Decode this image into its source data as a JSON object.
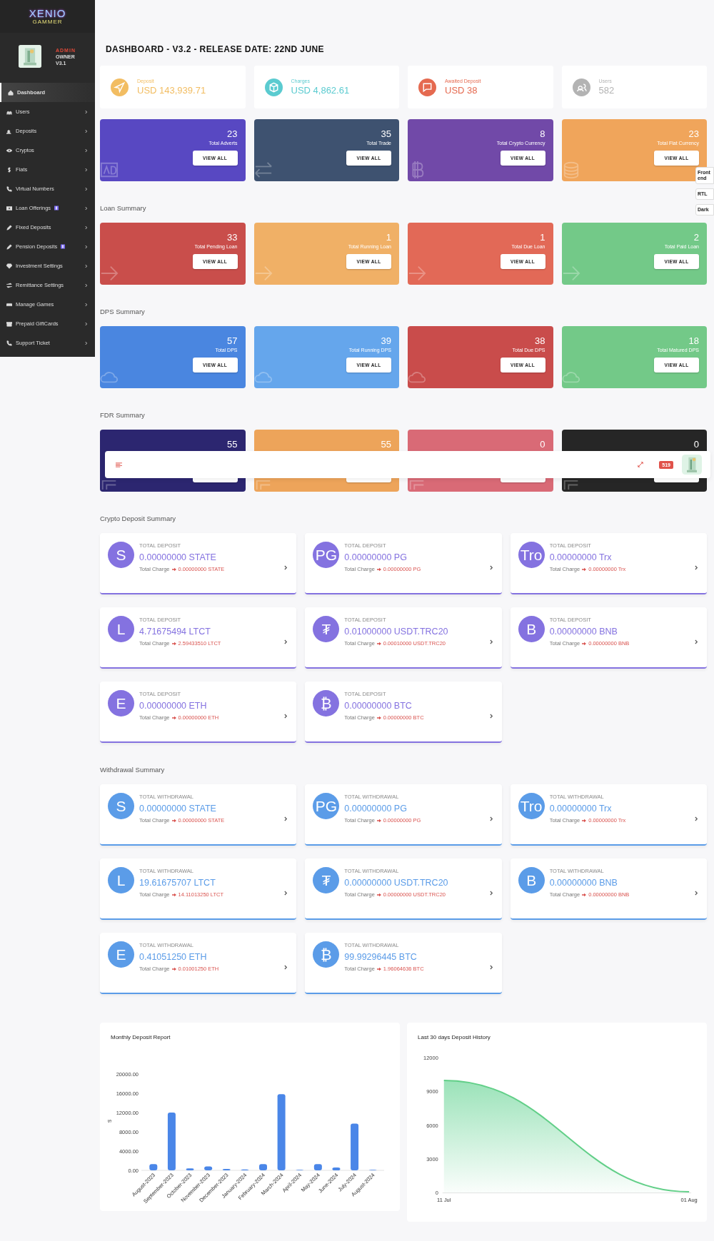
{
  "sidebar": {
    "logo": {
      "line1": "XENIO",
      "line2": "GAMMER"
    },
    "profile": {
      "role": "ADMIN",
      "title": "OWNER",
      "version": "V3.1"
    },
    "items": [
      {
        "label": "Dashboard",
        "selected": true,
        "badge": false,
        "submenu": false
      },
      {
        "label": "Users",
        "selected": false,
        "badge": false,
        "submenu": true
      },
      {
        "label": "Deposits",
        "selected": false,
        "badge": false,
        "submenu": true
      },
      {
        "label": "Cryptos",
        "selected": false,
        "badge": false,
        "submenu": true
      },
      {
        "label": "Fiats",
        "selected": false,
        "badge": false,
        "submenu": true
      },
      {
        "label": "Virtual Numbers",
        "selected": false,
        "badge": false,
        "submenu": true
      },
      {
        "label": "Loan Offerings",
        "selected": false,
        "badge": true,
        "submenu": true
      },
      {
        "label": "Fixed Deposits",
        "selected": false,
        "badge": false,
        "submenu": true
      },
      {
        "label": "Pension Deposits",
        "selected": false,
        "badge": true,
        "submenu": true
      },
      {
        "label": "Investment Settings",
        "selected": false,
        "badge": false,
        "submenu": true
      },
      {
        "label": "Remittance Settings",
        "selected": false,
        "badge": false,
        "submenu": true
      },
      {
        "label": "Manage Games",
        "selected": false,
        "badge": false,
        "submenu": true
      },
      {
        "label": "Prepaid GiftCards",
        "selected": false,
        "badge": false,
        "submenu": true
      },
      {
        "label": "Support Ticket",
        "selected": false,
        "badge": false,
        "submenu": true
      }
    ]
  },
  "side_tabs": [
    "Front end",
    "RTL",
    "Dark"
  ],
  "page_title": "DASHBOARD - V3.2 - RELEASE DATE: 22ND JUNE",
  "stats": [
    {
      "label": "Deposit",
      "value": "USD 143,939.71",
      "color": "#f2bd62"
    },
    {
      "label": "Charges",
      "value": "USD 4,862.61",
      "color": "#5bcbd0"
    },
    {
      "label": "Awaited Deposit",
      "value": "USD 38",
      "color": "#e56a50"
    },
    {
      "label": "Users",
      "value": "582",
      "color": "#b3b3b3"
    }
  ],
  "card_sections": [
    {
      "cards": [
        {
          "number": "23",
          "label": "Total Adverts",
          "button": "VIEW ALL",
          "color": "#5848c2"
        },
        {
          "number": "35",
          "label": "Total Trade",
          "button": "VIEW ALL",
          "color": "#3e5270"
        },
        {
          "number": "8",
          "label": "Total Crypto Currency",
          "button": "VIEW ALL",
          "color": "#7149a8"
        },
        {
          "number": "23",
          "label": "Total Flat Currency",
          "button": "VIEW ALL",
          "color": "#f0a55b"
        }
      ]
    },
    {
      "title": "Loan Summary",
      "cards": [
        {
          "number": "33",
          "label": "Total Pending Loan",
          "button": "VIEW ALL",
          "color": "#c94e4b"
        },
        {
          "number": "1",
          "label": "Total Running Loan",
          "button": "VIEW ALL",
          "color": "#f0b066"
        },
        {
          "number": "1",
          "label": "Total Due Loan",
          "button": "VIEW ALL",
          "color": "#e26957"
        },
        {
          "number": "2",
          "label": "Total Paid Loan",
          "button": "VIEW ALL",
          "color": "#73c988"
        }
      ]
    },
    {
      "title": "DPS Summary",
      "cards": [
        {
          "number": "57",
          "label": "Total DPS",
          "button": "VIEW ALL",
          "color": "#4a86e0"
        },
        {
          "number": "39",
          "label": "Total Running DPS",
          "button": "VIEW ALL",
          "color": "#65a6ec"
        },
        {
          "number": "38",
          "label": "Total Due DPS",
          "button": "VIEW ALL",
          "color": "#c94c4b"
        },
        {
          "number": "18",
          "label": "Total Matured DPS",
          "button": "VIEW ALL",
          "color": "#73c988"
        }
      ]
    },
    {
      "title": "FDR Summary",
      "header_overlay": {
        "notifications": "519"
      },
      "cards": [
        {
          "number": "55",
          "color": "#2c2670"
        },
        {
          "number": "55",
          "color": "#eda45a"
        },
        {
          "number": "0",
          "color": "#d96a76"
        },
        {
          "number": "0",
          "color": "#262626"
        }
      ]
    }
  ],
  "crypto_sections": [
    {
      "title": "Crypto Deposit Summary",
      "kind": "deposit",
      "cards": [
        {
          "symbol": "S",
          "label": "TOTAL DEPOSIT",
          "amount": "0.00000000 STATE",
          "charge_label": "Total Charge",
          "charge": "0.00000000 STATE"
        },
        {
          "symbol": "PG",
          "label": "TOTAL DEPOSIT",
          "amount": "0.00000000 PG",
          "charge_label": "Total Charge",
          "charge": "0.00000000 PG"
        },
        {
          "symbol": "Tro",
          "label": "TOTAL DEPOSIT",
          "amount": "0.00000000 Trx",
          "charge_label": "Total Charge",
          "charge": "0.00000000 Trx"
        },
        {
          "symbol": "L",
          "label": "TOTAL DEPOSIT",
          "amount": "4.71675494 LTCT",
          "charge_label": "Total Charge",
          "charge": "2.59433510 LTCT"
        },
        {
          "symbol": "₮",
          "label": "TOTAL DEPOSIT",
          "amount": "0.01000000 USDT.TRC20",
          "charge_label": "Total Charge",
          "charge": "0.00010000 USDT.TRC20"
        },
        {
          "symbol": "B",
          "label": "TOTAL DEPOSIT",
          "amount": "0.00000000 BNB",
          "charge_label": "Total Charge",
          "charge": "0.00000000 BNB"
        },
        {
          "symbol": "E",
          "label": "TOTAL DEPOSIT",
          "amount": "0.00000000 ETH",
          "charge_label": "Total Charge",
          "charge": "0.00000000 ETH"
        },
        {
          "symbol": "₿",
          "label": "TOTAL DEPOSIT",
          "amount": "0.00000000 BTC",
          "charge_label": "Total Charge",
          "charge": "0.00000000 BTC"
        }
      ]
    },
    {
      "title": "Withdrawal Summary",
      "kind": "withdrawal",
      "cards": [
        {
          "symbol": "S",
          "label": "TOTAL WITHDRAWAL",
          "amount": "0.00000000 STATE",
          "charge_label": "Total Charge",
          "charge": "0.00000000 STATE"
        },
        {
          "symbol": "PG",
          "label": "TOTAL WITHDRAWAL",
          "amount": "0.00000000 PG",
          "charge_label": "Total Charge",
          "charge": "0.00000000 PG"
        },
        {
          "symbol": "Tro",
          "label": "TOTAL WITHDRAWAL",
          "amount": "0.00000000 Trx",
          "charge_label": "Total Charge",
          "charge": "0.00000000 Trx"
        },
        {
          "symbol": "L",
          "label": "TOTAL WITHDRAWAL",
          "amount": "19.61675707 LTCT",
          "charge_label": "Total Charge",
          "charge": "14.11013250 LTCT"
        },
        {
          "symbol": "₮",
          "label": "TOTAL WITHDRAWAL",
          "amount": "0.00000000 USDT.TRC20",
          "charge_label": "Total Charge",
          "charge": "0.00000000 USDT.TRC20"
        },
        {
          "symbol": "B",
          "label": "TOTAL WITHDRAWAL",
          "amount": "0.00000000 BNB",
          "charge_label": "Total Charge",
          "charge": "0.00000000 BNB"
        },
        {
          "symbol": "E",
          "label": "TOTAL WITHDRAWAL",
          "amount": "0.41051250 ETH",
          "charge_label": "Total Charge",
          "charge": "0.01001250 ETH"
        },
        {
          "symbol": "₿",
          "label": "TOTAL WITHDRAWAL",
          "amount": "99.99296445 BTC",
          "charge_label": "Total Charge",
          "charge": "1.96064636 BTC"
        }
      ]
    }
  ],
  "charts": [
    {
      "chart_data": {
        "type": "bar",
        "title": "Monthly Deposit Report",
        "ylabel": "$",
        "categories": [
          "August-2023",
          "September-2023",
          "October-2023",
          "November-2023",
          "December-2023",
          "January-2024",
          "February-2024",
          "March-2024",
          "April-2024",
          "May-2024",
          "June-2024",
          "July-2024",
          "August-2024"
        ],
        "values": [
          1300,
          12000,
          400,
          800,
          300,
          200,
          1300,
          15800,
          100,
          1300,
          600,
          9700,
          100
        ],
        "ylim": [
          0,
          20000
        ],
        "yticks": [
          {
            "value": 0,
            "label": "0.00"
          },
          {
            "value": 4000,
            "label": "4000.00"
          },
          {
            "value": 8000,
            "label": "8000.00"
          },
          {
            "value": 12000,
            "label": "12000.00"
          },
          {
            "value": 16000,
            "label": "16000.00"
          },
          {
            "value": 20000,
            "label": "20000.00"
          }
        ]
      }
    },
    {
      "chart_data": {
        "type": "area",
        "title": "Last 30 days Deposit History",
        "x": [
          "11 Jul",
          "01 Aug"
        ],
        "values": [
          10000,
          100
        ],
        "ylim": [
          0,
          12000
        ],
        "yticks": [
          0,
          3000,
          6000,
          9000,
          12000
        ]
      }
    }
  ]
}
